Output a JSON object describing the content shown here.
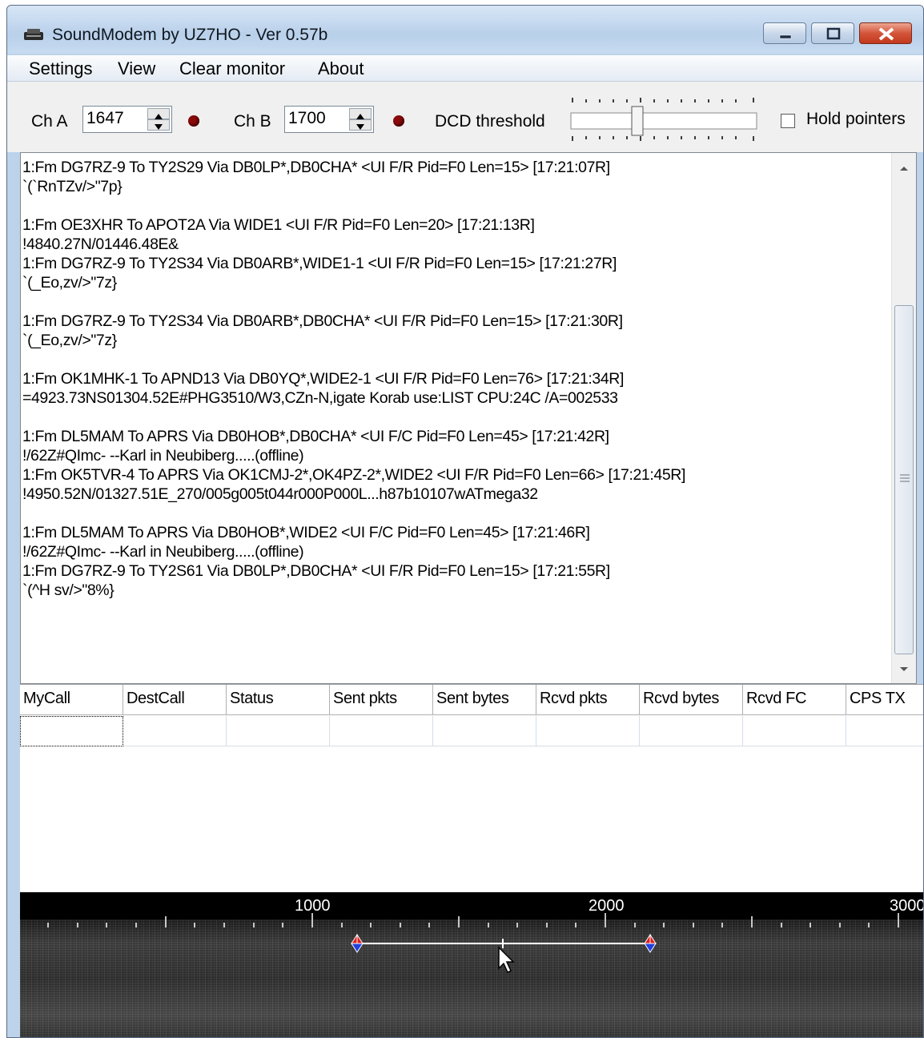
{
  "window": {
    "title": "SoundModem by UZ7HO - Ver 0.57b"
  },
  "menu": [
    "Settings",
    "View",
    "Clear monitor",
    "About"
  ],
  "toolbar": {
    "ch_a_label": "Ch A",
    "ch_a_value": "1647",
    "ch_b_label": "Ch B",
    "ch_b_value": "1700",
    "dcd_label": "DCD threshold",
    "hold_label": "Hold pointers"
  },
  "monitor": {
    "lines": [
      "1:Fm DG7RZ-9 To TY2S29 Via DB0LP*,DB0CHA* <UI F/R Pid=F0 Len=15> [17:21:07R]",
      "`(`RnTZv/>\"7p}",
      "",
      "1:Fm OE3XHR To APOT2A Via WIDE1 <UI F/R Pid=F0 Len=20> [17:21:13R]",
      "!4840.27N/01446.48E&",
      "1:Fm DG7RZ-9 To TY2S34 Via DB0ARB*,WIDE1-1 <UI F/R Pid=F0 Len=15> [17:21:27R]",
      "`(_Eo,zv/>\"7z}",
      "",
      "1:Fm DG7RZ-9 To TY2S34 Via DB0ARB*,DB0CHA* <UI F/R Pid=F0 Len=15> [17:21:30R]",
      "`(_Eo,zv/>\"7z}",
      "",
      "1:Fm OK1MHK-1 To APND13 Via DB0YQ*,WIDE2-1 <UI F/R Pid=F0 Len=76> [17:21:34R]",
      "=4923.73NS01304.52E#PHG3510/W3,CZn-N,igate Korab use:LIST CPU:24C /A=002533",
      "",
      "1:Fm DL5MAM To APRS Via DB0HOB*,DB0CHA* <UI F/C Pid=F0 Len=45> [17:21:42R]",
      "!/62Z#QImc- --Karl in Neubiberg.....(offline)",
      "1:Fm OK5TVR-4 To APRS Via OK1CMJ-2*,OK4PZ-2*,WIDE2 <UI F/R Pid=F0 Len=66> [17:21:45R]",
      "!4950.52N/01327.51E_270/005g005t044r000P000L...h87b10107wATmega32",
      "",
      "1:Fm DL5MAM To APRS Via DB0HOB*,WIDE2 <UI F/C Pid=F0 Len=45> [17:21:46R]",
      "!/62Z#QImc- --Karl in Neubiberg.....(offline)",
      "1:Fm DG7RZ-9 To TY2S61 Via DB0LP*,DB0CHA* <UI F/R Pid=F0 Len=15> [17:21:55R]",
      "`(^H sv/>\"8%}"
    ]
  },
  "grid": {
    "columns": [
      "MyCall",
      "DestCall",
      "Status",
      "Sent pkts",
      "Sent bytes",
      "Rcvd pkts",
      "Rcvd bytes",
      "Rcvd FC",
      "CPS TX"
    ]
  },
  "waterfall": {
    "scale_labels": [
      "1000",
      "2000",
      "3000"
    ]
  }
}
